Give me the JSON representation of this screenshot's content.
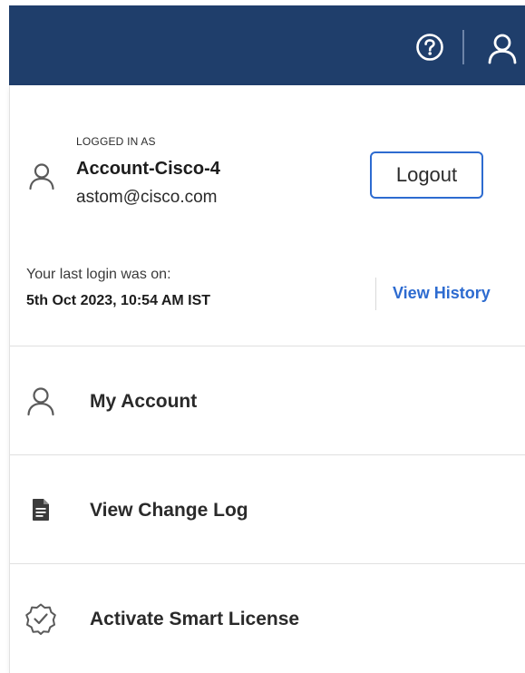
{
  "header": {
    "help_icon": "question-circle-icon",
    "user_icon": "user-icon",
    "background_color": "#1f3e6b"
  },
  "account": {
    "logged_in_label": "LOGGED IN AS",
    "name": "Account-Cisco-4",
    "email": "astom@cisco.com",
    "logout_label": "Logout",
    "avatar_icon": "user-icon"
  },
  "last_login": {
    "label": "Your last login was on:",
    "value": "5th Oct 2023, 10:54 AM IST",
    "view_history_label": "View History"
  },
  "menu": {
    "items": [
      {
        "label": "My Account",
        "icon": "user-icon"
      },
      {
        "label": "View Change Log",
        "icon": "document-icon"
      },
      {
        "label": "Activate Smart License",
        "icon": "badge-check-icon"
      }
    ]
  },
  "colors": {
    "accent": "#2d6bd0",
    "header": "#1f3e6b",
    "divider": "#e0e0e0"
  }
}
